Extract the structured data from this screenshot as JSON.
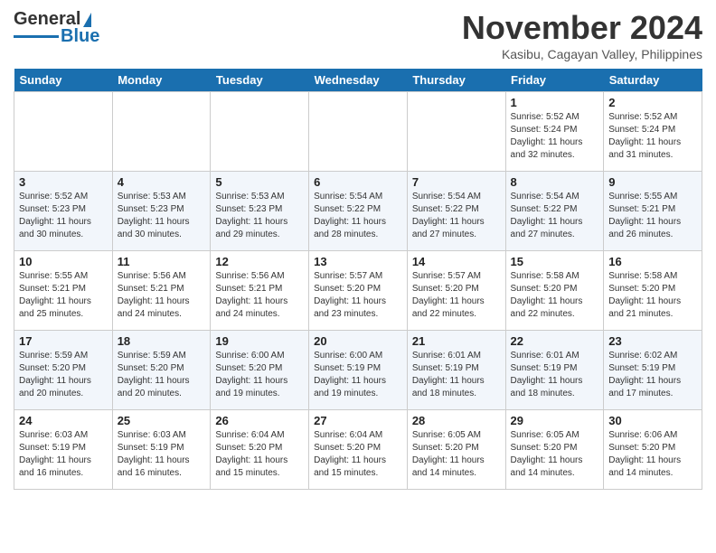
{
  "logo": {
    "general": "General",
    "blue": "Blue"
  },
  "header": {
    "month": "November 2024",
    "location": "Kasibu, Cagayan Valley, Philippines"
  },
  "weekdays": [
    "Sunday",
    "Monday",
    "Tuesday",
    "Wednesday",
    "Thursday",
    "Friday",
    "Saturday"
  ],
  "weeks": [
    [
      {
        "day": "",
        "info": ""
      },
      {
        "day": "",
        "info": ""
      },
      {
        "day": "",
        "info": ""
      },
      {
        "day": "",
        "info": ""
      },
      {
        "day": "",
        "info": ""
      },
      {
        "day": "1",
        "info": "Sunrise: 5:52 AM\nSunset: 5:24 PM\nDaylight: 11 hours\nand 32 minutes."
      },
      {
        "day": "2",
        "info": "Sunrise: 5:52 AM\nSunset: 5:24 PM\nDaylight: 11 hours\nand 31 minutes."
      }
    ],
    [
      {
        "day": "3",
        "info": "Sunrise: 5:52 AM\nSunset: 5:23 PM\nDaylight: 11 hours\nand 30 minutes."
      },
      {
        "day": "4",
        "info": "Sunrise: 5:53 AM\nSunset: 5:23 PM\nDaylight: 11 hours\nand 30 minutes."
      },
      {
        "day": "5",
        "info": "Sunrise: 5:53 AM\nSunset: 5:23 PM\nDaylight: 11 hours\nand 29 minutes."
      },
      {
        "day": "6",
        "info": "Sunrise: 5:54 AM\nSunset: 5:22 PM\nDaylight: 11 hours\nand 28 minutes."
      },
      {
        "day": "7",
        "info": "Sunrise: 5:54 AM\nSunset: 5:22 PM\nDaylight: 11 hours\nand 27 minutes."
      },
      {
        "day": "8",
        "info": "Sunrise: 5:54 AM\nSunset: 5:22 PM\nDaylight: 11 hours\nand 27 minutes."
      },
      {
        "day": "9",
        "info": "Sunrise: 5:55 AM\nSunset: 5:21 PM\nDaylight: 11 hours\nand 26 minutes."
      }
    ],
    [
      {
        "day": "10",
        "info": "Sunrise: 5:55 AM\nSunset: 5:21 PM\nDaylight: 11 hours\nand 25 minutes."
      },
      {
        "day": "11",
        "info": "Sunrise: 5:56 AM\nSunset: 5:21 PM\nDaylight: 11 hours\nand 24 minutes."
      },
      {
        "day": "12",
        "info": "Sunrise: 5:56 AM\nSunset: 5:21 PM\nDaylight: 11 hours\nand 24 minutes."
      },
      {
        "day": "13",
        "info": "Sunrise: 5:57 AM\nSunset: 5:20 PM\nDaylight: 11 hours\nand 23 minutes."
      },
      {
        "day": "14",
        "info": "Sunrise: 5:57 AM\nSunset: 5:20 PM\nDaylight: 11 hours\nand 22 minutes."
      },
      {
        "day": "15",
        "info": "Sunrise: 5:58 AM\nSunset: 5:20 PM\nDaylight: 11 hours\nand 22 minutes."
      },
      {
        "day": "16",
        "info": "Sunrise: 5:58 AM\nSunset: 5:20 PM\nDaylight: 11 hours\nand 21 minutes."
      }
    ],
    [
      {
        "day": "17",
        "info": "Sunrise: 5:59 AM\nSunset: 5:20 PM\nDaylight: 11 hours\nand 20 minutes."
      },
      {
        "day": "18",
        "info": "Sunrise: 5:59 AM\nSunset: 5:20 PM\nDaylight: 11 hours\nand 20 minutes."
      },
      {
        "day": "19",
        "info": "Sunrise: 6:00 AM\nSunset: 5:20 PM\nDaylight: 11 hours\nand 19 minutes."
      },
      {
        "day": "20",
        "info": "Sunrise: 6:00 AM\nSunset: 5:19 PM\nDaylight: 11 hours\nand 19 minutes."
      },
      {
        "day": "21",
        "info": "Sunrise: 6:01 AM\nSunset: 5:19 PM\nDaylight: 11 hours\nand 18 minutes."
      },
      {
        "day": "22",
        "info": "Sunrise: 6:01 AM\nSunset: 5:19 PM\nDaylight: 11 hours\nand 18 minutes."
      },
      {
        "day": "23",
        "info": "Sunrise: 6:02 AM\nSunset: 5:19 PM\nDaylight: 11 hours\nand 17 minutes."
      }
    ],
    [
      {
        "day": "24",
        "info": "Sunrise: 6:03 AM\nSunset: 5:19 PM\nDaylight: 11 hours\nand 16 minutes."
      },
      {
        "day": "25",
        "info": "Sunrise: 6:03 AM\nSunset: 5:19 PM\nDaylight: 11 hours\nand 16 minutes."
      },
      {
        "day": "26",
        "info": "Sunrise: 6:04 AM\nSunset: 5:20 PM\nDaylight: 11 hours\nand 15 minutes."
      },
      {
        "day": "27",
        "info": "Sunrise: 6:04 AM\nSunset: 5:20 PM\nDaylight: 11 hours\nand 15 minutes."
      },
      {
        "day": "28",
        "info": "Sunrise: 6:05 AM\nSunset: 5:20 PM\nDaylight: 11 hours\nand 14 minutes."
      },
      {
        "day": "29",
        "info": "Sunrise: 6:05 AM\nSunset: 5:20 PM\nDaylight: 11 hours\nand 14 minutes."
      },
      {
        "day": "30",
        "info": "Sunrise: 6:06 AM\nSunset: 5:20 PM\nDaylight: 11 hours\nand 14 minutes."
      }
    ]
  ]
}
